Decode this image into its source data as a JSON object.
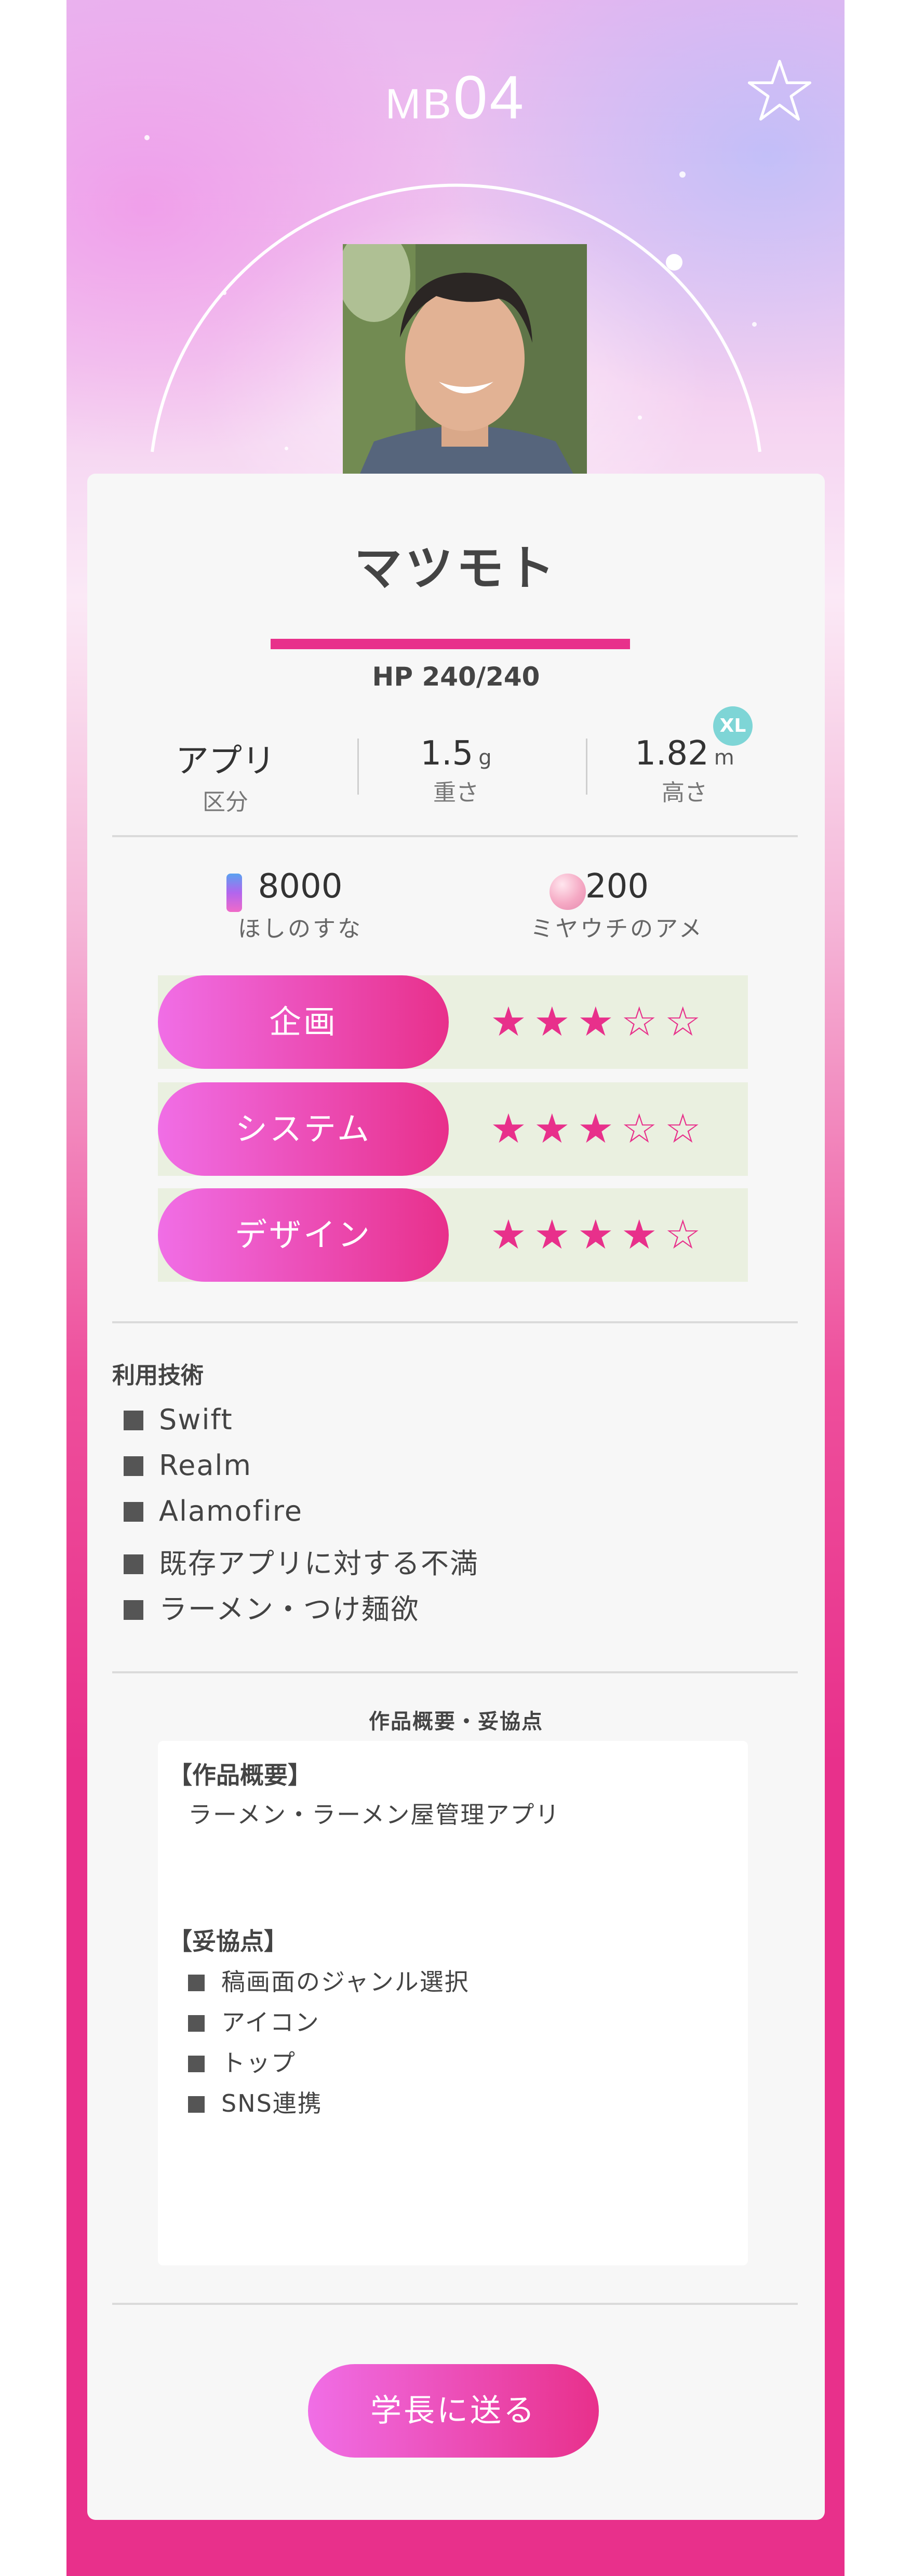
{
  "header": {
    "code_prefix": "MB",
    "code_number": "04",
    "favorite_icon": "star-outline-icon"
  },
  "profile": {
    "name": "マツモト",
    "hp_label": "HP 240/240",
    "hp_current": 240,
    "hp_max": 240
  },
  "stats": {
    "category": {
      "value": "アプリ",
      "label": "区分"
    },
    "weight": {
      "value": "1.5",
      "unit": "g",
      "label": "重さ"
    },
    "height": {
      "value": "1.82",
      "unit": "m",
      "label": "高さ",
      "badge": "XL"
    }
  },
  "resources": {
    "stardust": {
      "value": "8000",
      "label": "ほしのすな",
      "icon": "stardust-icon"
    },
    "candy": {
      "value": "200",
      "label": "ミヤウチのアメ",
      "icon": "candy-icon"
    }
  },
  "skills": [
    {
      "label": "企画",
      "stars": "★★★☆☆",
      "rating": 3,
      "max": 5
    },
    {
      "label": "システム",
      "stars": "★★★☆☆",
      "rating": 3,
      "max": 5
    },
    {
      "label": "デザイン",
      "stars": "★★★★☆",
      "rating": 4,
      "max": 5
    }
  ],
  "tech": {
    "title": "利用技術",
    "items": [
      "Swift",
      "Realm",
      "Alamofire",
      "既存アプリに対する不満",
      "ラーメン・つけ麺欲"
    ]
  },
  "summary": {
    "title": "作品概要・妥協点",
    "overview_heading": "【作品概要】",
    "overview_text": "ラーメン・ラーメン屋管理アプリ",
    "compromise_heading": "【妥協点】",
    "compromise_items": [
      "稿画面のジャンル選択",
      "アイコン",
      "トップ",
      "SNS連携"
    ]
  },
  "actions": {
    "send_label": "学長に送る"
  },
  "colors": {
    "accent": "#e8308b",
    "gradient_start": "#f06ee6",
    "badge": "#7ed5d6",
    "skill_bg": "#eaf0e0",
    "card_bg": "#f7f7f7"
  }
}
